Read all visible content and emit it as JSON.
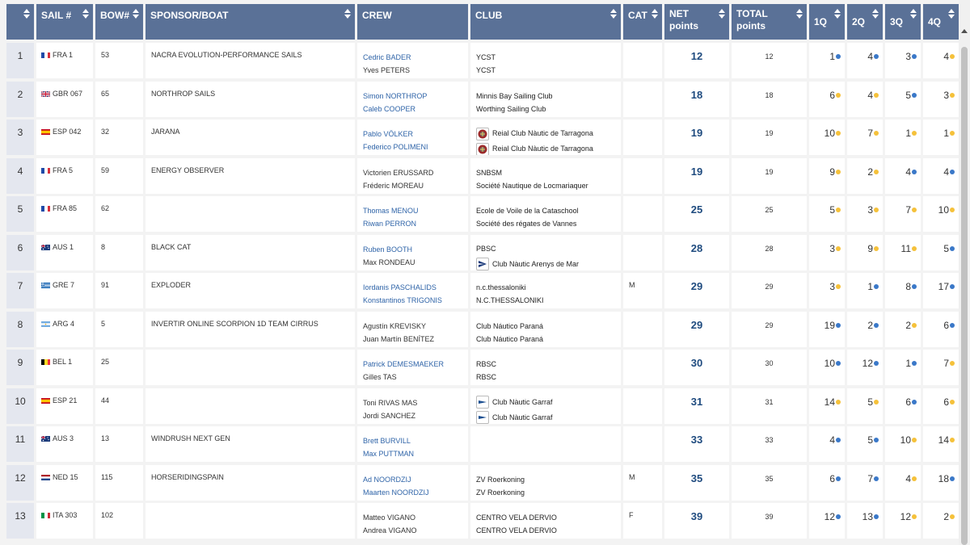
{
  "headers": {
    "sail": "SAIL #",
    "bow": "BOW#",
    "sponsor": "SPONSOR/BOAT",
    "crew": "CREW",
    "club": "CLUB",
    "cat": "CAT",
    "net": "NET points",
    "total": "TOTAL points",
    "q1": "1Q",
    "q2": "2Q",
    "q3": "3Q",
    "q4": "4Q"
  },
  "colors": {
    "blue_dot": "#3a78c8",
    "yellow_dot": "#f5c13a",
    "header_bg": "#5a7197",
    "net_text": "#1f4b7f",
    "link": "#2f64a8"
  },
  "rows": [
    {
      "rank": "1",
      "flag": "france",
      "sail": "FRA 1",
      "bow": "53",
      "sponsor": "NACRA EVOLUTION-PERFORMANCE SAILS",
      "crew1": "Cedric BADER",
      "crew1_link": true,
      "crew2": "Yves PETERS",
      "crew2_link": false,
      "club1": "YCST",
      "club1_icon": null,
      "club2": "YCST",
      "club2_icon": null,
      "cat": "",
      "net": "12",
      "total": "12",
      "q": [
        {
          "v": "1",
          "d": "blue"
        },
        {
          "v": "4",
          "d": "blue"
        },
        {
          "v": "3",
          "d": "blue"
        },
        {
          "v": "4",
          "d": "yellow"
        }
      ]
    },
    {
      "rank": "2",
      "flag": "uk",
      "sail": "GBR 067",
      "bow": "65",
      "sponsor": "NORTHROP SAILS",
      "crew1": "Simon NORTHROP",
      "crew1_link": true,
      "crew2": "Caleb COOPER",
      "crew2_link": true,
      "club1": "Minnis Bay Sailing Club",
      "club1_icon": null,
      "club2": "Worthing Sailing Club",
      "club2_icon": null,
      "cat": "",
      "net": "18",
      "total": "18",
      "q": [
        {
          "v": "6",
          "d": "yellow"
        },
        {
          "v": "4",
          "d": "yellow"
        },
        {
          "v": "5",
          "d": "blue"
        },
        {
          "v": "3",
          "d": "yellow"
        }
      ]
    },
    {
      "rank": "3",
      "flag": "spain",
      "sail": "ESP 042",
      "bow": "32",
      "sponsor": "JARANA",
      "crew1": "Pablo VÖLKER",
      "crew1_link": true,
      "crew2": "Federico POLIMENI",
      "crew2_link": true,
      "club1": "Reial Club Nàutic de Tarragona",
      "club1_icon": "tarragona-burgee-icon",
      "club2": "Reial Club Nàutic de Tarragona",
      "club2_icon": "tarragona-burgee-icon",
      "cat": "",
      "net": "19",
      "total": "19",
      "q": [
        {
          "v": "10",
          "d": "yellow"
        },
        {
          "v": "7",
          "d": "yellow"
        },
        {
          "v": "1",
          "d": "yellow"
        },
        {
          "v": "1",
          "d": "yellow"
        }
      ]
    },
    {
      "rank": "4",
      "flag": "france",
      "sail": "FRA 5",
      "bow": "59",
      "sponsor": "ENERGY OBSERVER",
      "crew1": "Victorien ERUSSARD",
      "crew1_link": false,
      "crew2": "Fréderic MOREAU",
      "crew2_link": false,
      "club1": "SNBSM",
      "club1_icon": null,
      "club2": "Société Nautique de Locmariaquer",
      "club2_icon": null,
      "cat": "",
      "net": "19",
      "total": "19",
      "q": [
        {
          "v": "9",
          "d": "yellow"
        },
        {
          "v": "2",
          "d": "yellow"
        },
        {
          "v": "4",
          "d": "blue"
        },
        {
          "v": "4",
          "d": "blue"
        }
      ]
    },
    {
      "rank": "5",
      "flag": "france",
      "sail": "FRA 85",
      "bow": "62",
      "sponsor": "",
      "crew1": "Thomas MENOU",
      "crew1_link": true,
      "crew2": "Riwan PERRON",
      "crew2_link": true,
      "club1": "Ecole de Voile de la Cataschool",
      "club1_icon": null,
      "club2": "Société des régates de Vannes",
      "club2_icon": null,
      "cat": "",
      "net": "25",
      "total": "25",
      "q": [
        {
          "v": "5",
          "d": "yellow"
        },
        {
          "v": "3",
          "d": "yellow"
        },
        {
          "v": "7",
          "d": "yellow"
        },
        {
          "v": "10",
          "d": "yellow"
        }
      ]
    },
    {
      "rank": "6",
      "flag": "australia",
      "sail": "AUS 1",
      "bow": "8",
      "sponsor": "BLACK CAT",
      "crew1": "Ruben BOOTH",
      "crew1_link": true,
      "crew2": "Max RONDEAU",
      "crew2_link": false,
      "club1": "PBSC",
      "club1_icon": null,
      "club2": "Club Nàutic Arenys de Mar",
      "club2_icon": "arenys-burgee-icon",
      "cat": "",
      "net": "28",
      "total": "28",
      "q": [
        {
          "v": "3",
          "d": "yellow"
        },
        {
          "v": "9",
          "d": "yellow"
        },
        {
          "v": "11",
          "d": "yellow"
        },
        {
          "v": "5",
          "d": "blue"
        }
      ]
    },
    {
      "rank": "7",
      "flag": "greece",
      "sail": "GRE 7",
      "bow": "91",
      "sponsor": "EXPLODER",
      "crew1": "Iordanis PASCHALIDS",
      "crew1_link": true,
      "crew2": "Konstantinos TRIGONIS",
      "crew2_link": true,
      "club1": "n.c.thessaloniki",
      "club1_icon": null,
      "club2": "N.C.THESSALONIKI",
      "club2_icon": null,
      "cat": "M",
      "net": "29",
      "total": "29",
      "q": [
        {
          "v": "3",
          "d": "yellow"
        },
        {
          "v": "1",
          "d": "blue"
        },
        {
          "v": "8",
          "d": "blue"
        },
        {
          "v": "17",
          "d": "blue"
        }
      ]
    },
    {
      "rank": "8",
      "flag": "argentina",
      "sail": "ARG 4",
      "bow": "5",
      "sponsor": "INVERTIR ONLINE SCORPION 1D TEAM CIRRUS",
      "crew1": "Agustín KREVISKY",
      "crew1_link": false,
      "crew2": "Juan Martín BENÍTEZ",
      "crew2_link": false,
      "club1": "Club Náutico Paraná",
      "club1_icon": null,
      "club2": "Club Náutico Paraná",
      "club2_icon": null,
      "cat": "",
      "net": "29",
      "total": "29",
      "q": [
        {
          "v": "19",
          "d": "blue"
        },
        {
          "v": "2",
          "d": "blue"
        },
        {
          "v": "2",
          "d": "yellow"
        },
        {
          "v": "6",
          "d": "blue"
        }
      ]
    },
    {
      "rank": "9",
      "flag": "belgium",
      "sail": "BEL 1",
      "bow": "25",
      "sponsor": "",
      "crew1": "Patrick DEMESMAEKER",
      "crew1_link": true,
      "crew2": "Gilles TAS",
      "crew2_link": false,
      "club1": "RBSC",
      "club1_icon": null,
      "club2": "RBSC",
      "club2_icon": null,
      "cat": "",
      "net": "30",
      "total": "30",
      "q": [
        {
          "v": "10",
          "d": "blue"
        },
        {
          "v": "12",
          "d": "blue"
        },
        {
          "v": "1",
          "d": "blue"
        },
        {
          "v": "7",
          "d": "yellow"
        }
      ]
    },
    {
      "rank": "10",
      "flag": "spain",
      "sail": "ESP 21",
      "bow": "44",
      "sponsor": "",
      "crew1": "Toni RIVAS MAS",
      "crew1_link": false,
      "crew2": "Jordi SANCHEZ",
      "crew2_link": false,
      "club1": "Club Nàutic Garraf",
      "club1_icon": "garraf-burgee-icon",
      "club2": "Club Nàutic Garraf",
      "club2_icon": "garraf-burgee-icon",
      "cat": "",
      "net": "31",
      "total": "31",
      "q": [
        {
          "v": "14",
          "d": "yellow"
        },
        {
          "v": "5",
          "d": "yellow"
        },
        {
          "v": "6",
          "d": "blue"
        },
        {
          "v": "6",
          "d": "yellow"
        }
      ]
    },
    {
      "rank": "11",
      "flag": "australia",
      "sail": "AUS 3",
      "bow": "13",
      "sponsor": "WINDRUSH NEXT GEN",
      "crew1": "Brett BURVILL",
      "crew1_link": true,
      "crew2": "Max PUTTMAN",
      "crew2_link": true,
      "club1": "",
      "club1_icon": null,
      "club2": "",
      "club2_icon": null,
      "cat": "",
      "net": "33",
      "total": "33",
      "q": [
        {
          "v": "4",
          "d": "blue"
        },
        {
          "v": "5",
          "d": "blue"
        },
        {
          "v": "10",
          "d": "yellow"
        },
        {
          "v": "14",
          "d": "yellow"
        }
      ]
    },
    {
      "rank": "12",
      "flag": "netherlands",
      "sail": "NED 15",
      "bow": "115",
      "sponsor": "HORSERIDINGSPAIN",
      "crew1": "Ad NOORDZIJ",
      "crew1_link": true,
      "crew2": "Maarten NOORDZIJ",
      "crew2_link": true,
      "club1": "ZV Roerkoning",
      "club1_icon": null,
      "club2": "ZV Roerkoning",
      "club2_icon": null,
      "cat": "M",
      "net": "35",
      "total": "35",
      "q": [
        {
          "v": "6",
          "d": "blue"
        },
        {
          "v": "7",
          "d": "blue"
        },
        {
          "v": "4",
          "d": "yellow"
        },
        {
          "v": "18",
          "d": "blue"
        }
      ]
    },
    {
      "rank": "13",
      "flag": "italy",
      "sail": "ITA 303",
      "bow": "102",
      "sponsor": "",
      "crew1": "Matteo VIGANO",
      "crew1_link": false,
      "crew2": "Andrea VIGANO",
      "crew2_link": false,
      "club1": "CENTRO VELA DERVIO",
      "club1_icon": null,
      "club2": "CENTRO VELA DERVIO",
      "club2_icon": null,
      "cat": "F",
      "net": "39",
      "total": "39",
      "q": [
        {
          "v": "12",
          "d": "blue"
        },
        {
          "v": "13",
          "d": "blue"
        },
        {
          "v": "12",
          "d": "yellow"
        },
        {
          "v": "2",
          "d": "yellow"
        }
      ]
    }
  ]
}
